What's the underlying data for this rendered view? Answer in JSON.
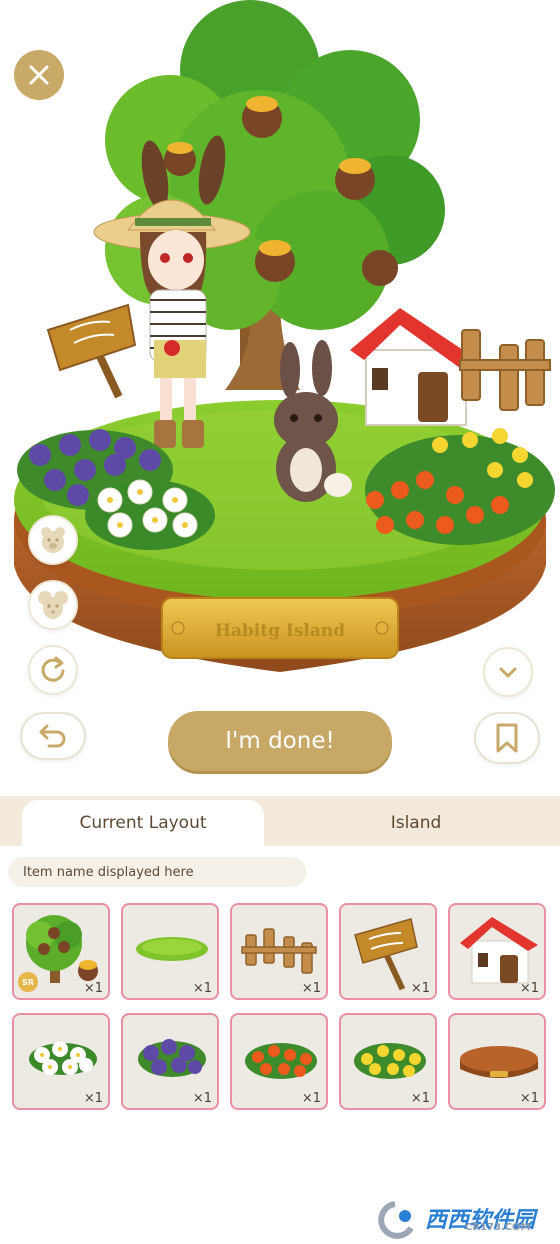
{
  "scene": {
    "plaque_text": "Habitg Island"
  },
  "buttons": {
    "close": "close",
    "done_label": "I'm done!"
  },
  "tabs": [
    {
      "label": "Current Layout",
      "active": true
    },
    {
      "label": "Island",
      "active": false
    }
  ],
  "item_name_placeholder": "Item name displayed here",
  "items": [
    {
      "icon": "tree-icon",
      "qty": "×1",
      "badge": "SR"
    },
    {
      "icon": "grass-patch-icon",
      "qty": "×1"
    },
    {
      "icon": "wooden-fence-icon",
      "qty": "×1"
    },
    {
      "icon": "signpost-icon",
      "qty": "×1"
    },
    {
      "icon": "house-icon",
      "qty": "×1"
    },
    {
      "icon": "white-flowers-icon",
      "qty": "×1"
    },
    {
      "icon": "purple-flowers-icon",
      "qty": "×1"
    },
    {
      "icon": "orange-flowers-icon",
      "qty": "×1"
    },
    {
      "icon": "yellow-flowers-icon",
      "qty": "×1"
    },
    {
      "icon": "island-base-icon",
      "qty": "×1"
    }
  ],
  "watermark": {
    "main": "西西软件园",
    "sub": "CR173.COM"
  },
  "colors": {
    "accent_gold": "#c7a867",
    "tab_bar": "#f3eadb",
    "item_border": "#ea8fa4",
    "item_bg": "#ede9e3"
  }
}
